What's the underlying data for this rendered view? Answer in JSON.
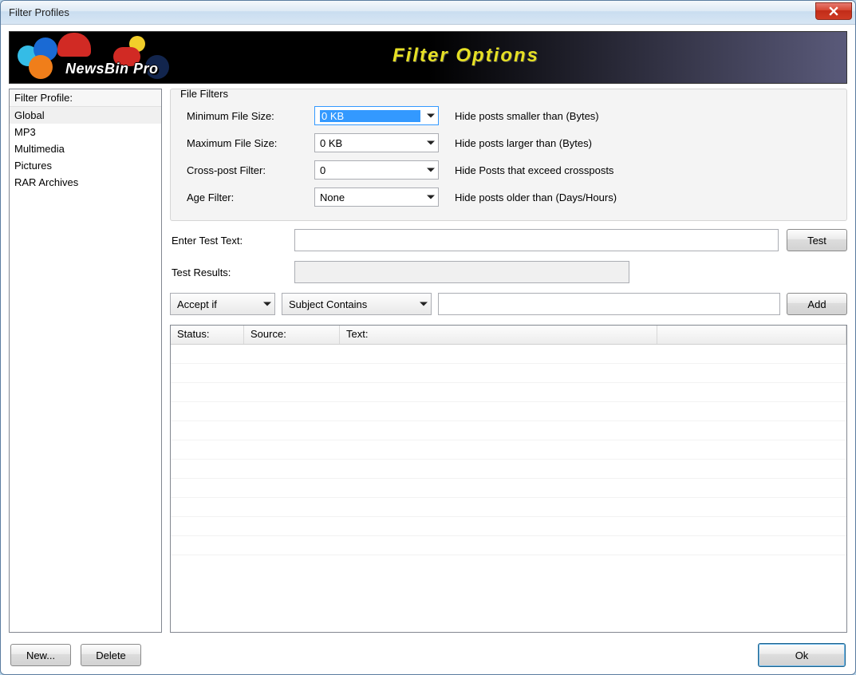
{
  "window": {
    "title": "Filter Profiles"
  },
  "banner": {
    "logo_text": "NewsBin Pro",
    "title": "Filter Options"
  },
  "sidebar": {
    "header": "Filter Profile:",
    "items": [
      "Global",
      "MP3",
      "Multimedia",
      "Pictures",
      "RAR Archives"
    ],
    "selected_index": 0
  },
  "file_filters": {
    "legend": "File Filters",
    "rows": [
      {
        "label": "Minimum File Size:",
        "value": "0 KB",
        "hint": "Hide posts smaller than (Bytes)",
        "focused": true
      },
      {
        "label": "Maximum File Size:",
        "value": "0 KB",
        "hint": "Hide posts larger than (Bytes)",
        "focused": false
      },
      {
        "label": "Cross-post Filter:",
        "value": "0",
        "hint": "Hide Posts that exceed crossposts",
        "focused": false
      },
      {
        "label": "Age Filter:",
        "value": "None",
        "hint": "Hide posts older than (Days/Hours)",
        "focused": false
      }
    ]
  },
  "test": {
    "enter_label": "Enter Test Text:",
    "enter_value": "",
    "test_button": "Test",
    "results_label": "Test Results:",
    "results_value": ""
  },
  "rule": {
    "action_select": "Accept if",
    "field_select": "Subject Contains",
    "value": "",
    "add_button": "Add"
  },
  "table": {
    "columns": [
      "Status:",
      "Source:",
      "Text:",
      ""
    ],
    "rows": []
  },
  "footer": {
    "new_button": "New...",
    "delete_button": "Delete",
    "ok_button": "Ok"
  }
}
